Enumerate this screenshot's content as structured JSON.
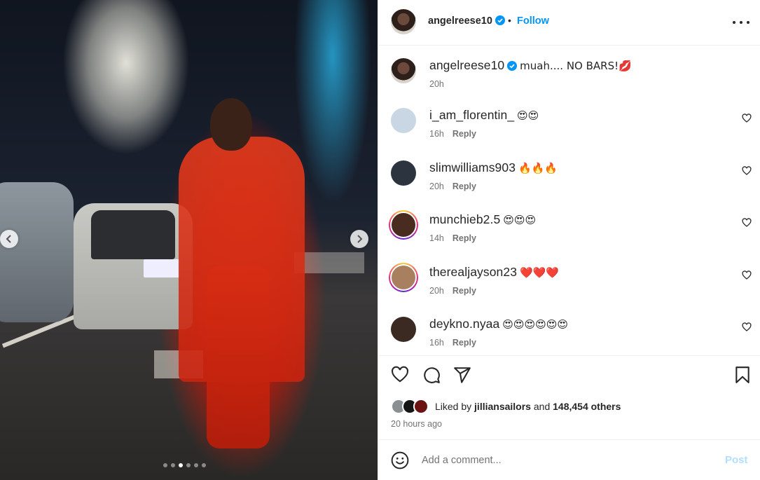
{
  "post": {
    "username": "angelreese10",
    "separator": "•",
    "follow_label": "Follow",
    "caption_text": "muah.... NO BARS!💋",
    "caption_time": "20h",
    "image_alt": "Woman in red outfit standing on a city street at night with cars and lit billboards",
    "carousel": {
      "total": 6,
      "active_index": 2
    }
  },
  "comments": [
    {
      "username": "i_am_florentin_",
      "text": "😍😍",
      "time": "16h",
      "reply_label": "Reply",
      "ring": false,
      "avatar_color": "#c9d6e3"
    },
    {
      "username": "slimwilliams903",
      "text": "🔥🔥🔥",
      "time": "20h",
      "reply_label": "Reply",
      "ring": false,
      "avatar_color": "#2c3440"
    },
    {
      "username": "munchieb2.5",
      "text": "😍😍😍",
      "time": "14h",
      "reply_label": "Reply",
      "ring": true,
      "avatar_color": "#4a2b20"
    },
    {
      "username": "therealjayson23",
      "text": "❤️❤️❤️",
      "time": "20h",
      "reply_label": "Reply",
      "ring": true,
      "avatar_color": "#a9805f"
    },
    {
      "username": "deykno.nyaa",
      "text": "😍😍😍😍😍😍",
      "time": "16h",
      "reply_label": "Reply",
      "ring": false,
      "avatar_color": "#3b2a22"
    }
  ],
  "likes": {
    "prefix": "Liked by ",
    "liker": "jilliansailors",
    "middle": " and ",
    "count_text": "148,454 others"
  },
  "timestamp": "20 hours ago",
  "add_comment": {
    "placeholder": "Add a comment...",
    "post_label": "Post"
  },
  "colors": {
    "accent": "#0095f6",
    "post_disabled": "#b2dffc",
    "verified": "#0095f6"
  },
  "icons": {
    "header_more": "more-horizontal-icon",
    "like": "heart-icon",
    "comment": "comment-icon",
    "share": "share-icon",
    "save": "bookmark-icon",
    "emoji": "emoji-icon",
    "prev": "chevron-left-icon",
    "next": "chevron-right-icon"
  }
}
